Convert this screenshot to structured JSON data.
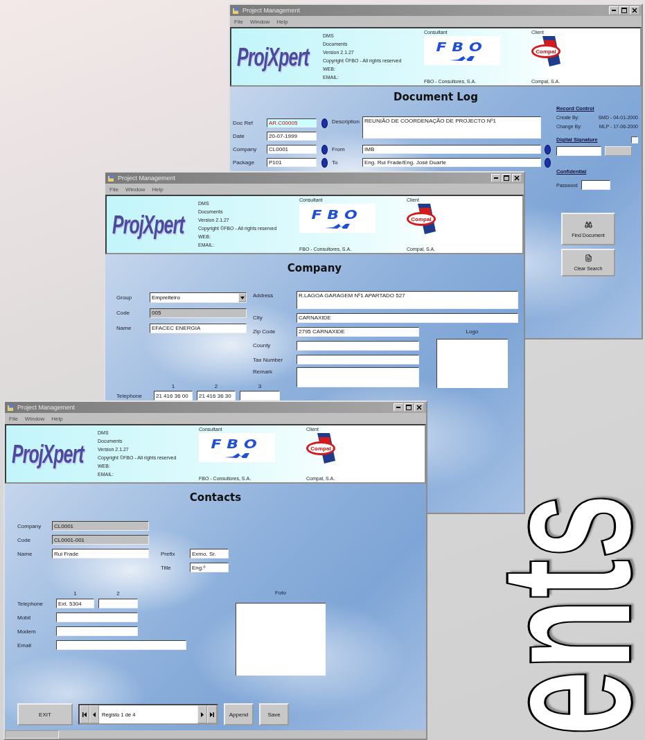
{
  "backdrop": {
    "word": "ents"
  },
  "document_log_window": {
    "title": "Project Management",
    "menu": [
      "File",
      "Window",
      "Help"
    ],
    "header": {
      "logo": "ProjXpert",
      "info": [
        "DMS",
        "Documents",
        "Version 2.1.27",
        "Copyright ©FBO - All rights reserved",
        "WEB:",
        "EMAIL:"
      ],
      "consultant_label": "Consultant",
      "consultant_logo": "FBO",
      "consultant_name": "FBO - Consultores, S.A.",
      "client_label": "Client",
      "client_logo": "Compal",
      "client_name": "Compal, S.A."
    },
    "heading": "Document Log",
    "fields": [
      {
        "label": "Doc Ref",
        "value": "AR.C00005",
        "highlighted": true,
        "lookup": true
      },
      {
        "label": "Date",
        "value": "20-07-1999",
        "highlighted": false,
        "lookup": false
      },
      {
        "label": "Company",
        "value": "CL0001",
        "highlighted": false,
        "lookup": true
      },
      {
        "label": "Package",
        "value": "P101",
        "highlighted": false,
        "lookup": true
      }
    ],
    "description": {
      "label": "Description",
      "value": "REUNIÃO DE COORDENAÇÃO DE PROJECTO Nº1"
    },
    "from": {
      "label": "From",
      "value": "IMB",
      "lookup": true
    },
    "to": {
      "label": "To",
      "value": "Eng. Rui Frade/Eng. José Duarte",
      "lookup": true
    },
    "record_control": {
      "title": "Record Control",
      "lines": [
        {
          "label": "Create By:",
          "value": "SMD - 04-01-2000"
        },
        {
          "label": "Change By:",
          "value": "MLP - 17-06-2000"
        }
      ]
    },
    "digital_signature": {
      "label": "Digital Signature",
      "checked": false
    },
    "confidential": {
      "title": "Confidential",
      "password_label": "Password"
    },
    "buttons": [
      {
        "label": "Find Document",
        "kind": "find"
      },
      {
        "label": "Clear Search",
        "kind": "clear"
      }
    ]
  },
  "company_window": {
    "title": "Project Management",
    "menu": [
      "File",
      "Window",
      "Help"
    ],
    "header": {
      "logo": "ProjXpert",
      "info": [
        "DMS",
        "Documents",
        "Version 2.1.27",
        "Copyright ©FBO - All rights reserved",
        "WEB:",
        "EMAIL:"
      ],
      "consultant_label": "Consultant",
      "consultant_logo": "FBO",
      "consultant_name": "FBO - Consultores, S.A.",
      "client_label": "Client",
      "client_logo": "Compal",
      "client_name": "Compal, S.A."
    },
    "heading": "Company",
    "group": {
      "label": "Group",
      "value": "Empreiteiro"
    },
    "left_fields": [
      {
        "label": "Code",
        "value": "005",
        "disabled": true
      },
      {
        "label": "Name",
        "value": "EFACEC ENERGIA",
        "disabled": false
      }
    ],
    "right_fields": [
      {
        "label": "Address",
        "value": "R.LAGOA GARAGEM Nº1 APARTADO 527",
        "kind": "multiline"
      },
      {
        "label": "City",
        "value": "CARNAXIDE",
        "kind": "wide"
      },
      {
        "label": "Zip Code",
        "value": "2795 CARNAXIDE",
        "kind": "short"
      },
      {
        "label": "County",
        "kind": "short"
      },
      {
        "label": "Tax Number",
        "kind": "short"
      },
      {
        "label": "Remark",
        "kind": "memo"
      }
    ],
    "logo_label": "Logo",
    "telephone": {
      "label": "Telephone",
      "columns": [
        "1",
        "2",
        "3"
      ],
      "values": [
        "21 416 36 00",
        "21 416 36 30"
      ]
    }
  },
  "contacts_window": {
    "title": "Project Management",
    "menu": [
      "File",
      "Window",
      "Help"
    ],
    "header": {
      "logo": "ProjXpert",
      "info": [
        "DMS",
        "Documents",
        "Version 2.1.27",
        "Copyright ©FBO - All rights reserved",
        "WEB:",
        "EMAIL:"
      ],
      "consultant_label": "Consultant",
      "consultant_logo": "FBO",
      "consultant_name": "FBO - Consultores, S.A.",
      "client_label": "Client",
      "client_logo": "Compal",
      "client_name": "Compal, S.A."
    },
    "heading": "Contacts",
    "fields": [
      {
        "label": "Company",
        "value": "CL0001",
        "disabled": true
      },
      {
        "label": "Code",
        "value": "CL0001-001",
        "disabled": true
      },
      {
        "label": "Name",
        "value": "Rui Frade",
        "disabled": false
      }
    ],
    "prefix": {
      "label": "Prefix",
      "value": "Exmo. Sr."
    },
    "title_field": {
      "label": "Title",
      "value": "Eng.º"
    },
    "telephone": {
      "label": "Telephone",
      "columns": [
        "1",
        "2"
      ],
      "values": [
        "Ext. 5304"
      ]
    },
    "other_fields": [
      {
        "label": "Mobil",
        "kind": "short"
      },
      {
        "label": "Modem",
        "kind": "short"
      },
      {
        "label": "Email",
        "kind": "long"
      }
    ],
    "photo_label": "Foto",
    "exit": "EXIT",
    "navigator": {
      "record": "Registo 1 de 4"
    },
    "actions": [
      "Append",
      "Save"
    ]
  }
}
